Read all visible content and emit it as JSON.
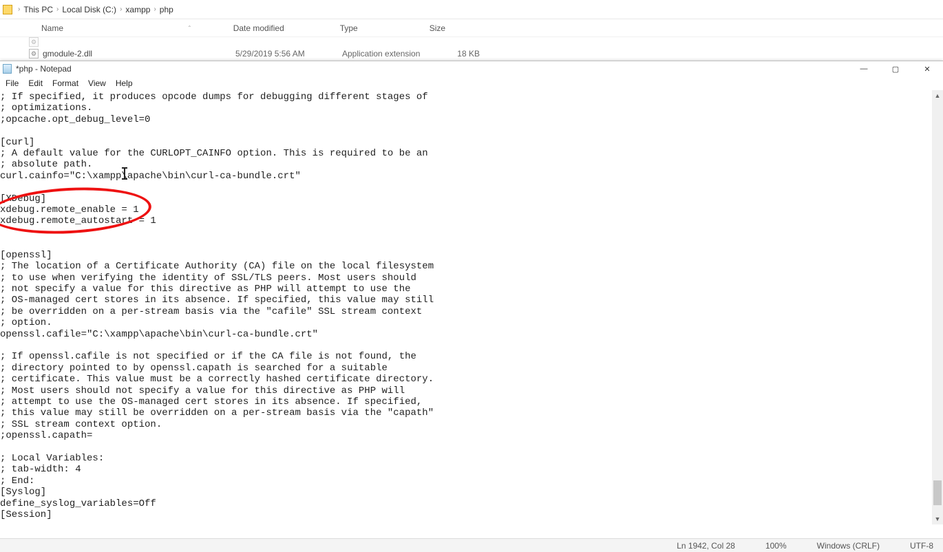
{
  "explorer": {
    "breadcrumb": [
      "This PC",
      "Local Disk (C:)",
      "xampp",
      "php"
    ],
    "columns": {
      "name": "Name",
      "date": "Date modified",
      "type": "Type",
      "size": "Size"
    },
    "rows": [
      {
        "name": "gmodule-2.dll",
        "date": "5/29/2019 5:56 AM",
        "type": "Application extension",
        "size": "18 KB"
      }
    ]
  },
  "notepad": {
    "title": "*php - Notepad",
    "menu": [
      "File",
      "Edit",
      "Format",
      "View",
      "Help"
    ],
    "content": "; If specified, it produces opcode dumps for debugging different stages of\n; optimizations.\n;opcache.opt_debug_level=0\n\n[curl]\n; A default value for the CURLOPT_CAINFO option. This is required to be an\n; absolute path.\ncurl.cainfo=\"C:\\xampp\\apache\\bin\\curl-ca-bundle.crt\"\n\n[XDebug]\nxdebug.remote_enable = 1\nxdebug.remote_autostart = 1\n\n\n[openssl]\n; The location of a Certificate Authority (CA) file on the local filesystem\n; to use when verifying the identity of SSL/TLS peers. Most users should\n; not specify a value for this directive as PHP will attempt to use the\n; OS-managed cert stores in its absence. If specified, this value may still\n; be overridden on a per-stream basis via the \"cafile\" SSL stream context\n; option.\nopenssl.cafile=\"C:\\xampp\\apache\\bin\\curl-ca-bundle.crt\"\n\n; If openssl.cafile is not specified or if the CA file is not found, the\n; directory pointed to by openssl.capath is searched for a suitable\n; certificate. This value must be a correctly hashed certificate directory.\n; Most users should not specify a value for this directive as PHP will\n; attempt to use the OS-managed cert stores in its absence. If specified,\n; this value may still be overridden on a per-stream basis via the \"capath\"\n; SSL stream context option.\n;openssl.capath=\n\n; Local Variables:\n; tab-width: 4\n; End:\n[Syslog]\ndefine_syslog_variables=Off\n[Session]",
    "status": {
      "position": "Ln 1942, Col 28",
      "zoom": "100%",
      "line_ending": "Windows (CRLF)",
      "encoding": "UTF-8"
    },
    "window_controls": {
      "min": "—",
      "max": "▢",
      "close": "✕"
    }
  }
}
